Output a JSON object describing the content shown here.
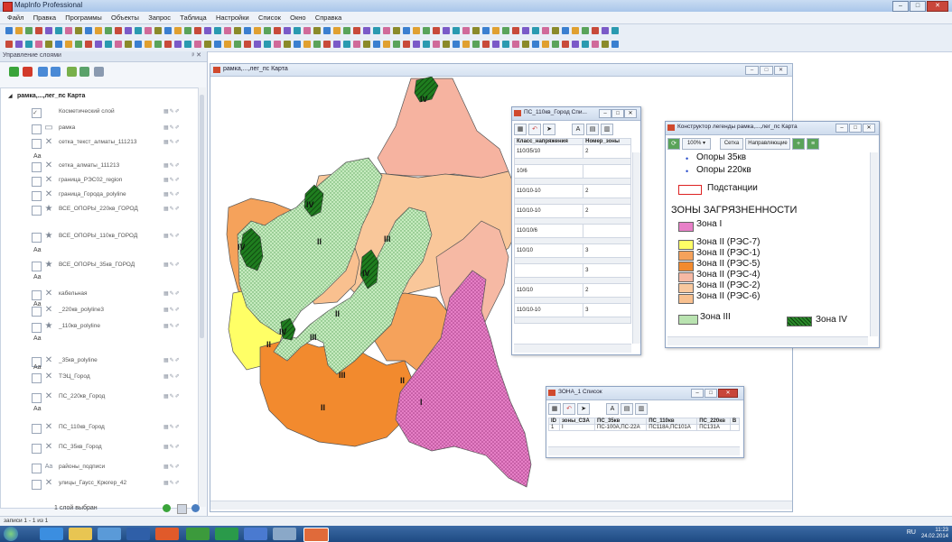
{
  "app": {
    "title": "MapInfo Professional"
  },
  "menu": [
    "Файл",
    "Правка",
    "Программы",
    "Объекты",
    "Запрос",
    "Таблица",
    "Настройки",
    "Список",
    "Окно",
    "Справка"
  ],
  "layer_panel": {
    "title": "Управление слоями",
    "map_name": "рамка,...,лег_пс Карта",
    "aa": "Aa",
    "layers": [
      {
        "name": "Косметический слой"
      },
      {
        "name": "рамка"
      },
      {
        "name": "сетка_текст_алматы_111213"
      },
      {
        "name": "сетка_алматы_111213"
      },
      {
        "name": "граница_РЭС02_region"
      },
      {
        "name": "граница_Города_polyline"
      },
      {
        "name": "ВСЕ_ОПОРЫ_220кв_ГОРОД"
      },
      {
        "name": "ВСЕ_ОПОРЫ_110кв_ГОРОД"
      },
      {
        "name": "ВСЕ_ОПОРЫ_35кв_ГОРОД"
      },
      {
        "name": "кабельная"
      },
      {
        "name": "_220кв_polyline3"
      },
      {
        "name": "_110кв_polyline"
      },
      {
        "name": "_35кв_polyline"
      },
      {
        "name": "ТЭЦ_Город"
      },
      {
        "name": "ПС_220кв_Город"
      },
      {
        "name": "ПС_110кв_Город"
      },
      {
        "name": "ПС_35кв_Город"
      },
      {
        "name": "районы_подписи"
      },
      {
        "name": "улицы_Гаусс_Крюгер_42"
      }
    ],
    "footer": "1 слой выбран"
  },
  "map_window": {
    "title": "рамка,...,лег_пс Карта",
    "labels": {
      "z1": "I",
      "z2": "II",
      "z3": "III",
      "z4": "IV"
    }
  },
  "ps_list": {
    "title": "ПС_110кв_Город Спи...",
    "columns": [
      "Класс_напряжения",
      "Номер_зоны"
    ],
    "rows": [
      [
        "110/35/10",
        "2"
      ],
      [
        "10/6",
        ""
      ],
      [
        "110/10-10",
        "2"
      ],
      [
        "110/10-10",
        "2"
      ],
      [
        "110/10/6",
        ""
      ],
      [
        "110/10",
        "3"
      ],
      [
        "",
        "3"
      ],
      [
        "110/10",
        "2"
      ],
      [
        "110/10-10",
        "3"
      ]
    ]
  },
  "legend": {
    "title": "Конструктор легенды рамка,...,лег_пс Карта",
    "zoom": "100%",
    "btn_grid": "Сетка",
    "btn_guides": "Направляющие",
    "items": {
      "op35": "Опоры 35кв",
      "op220": "Опоры 220кв",
      "subst": "Подстанции",
      "header": "ЗОНЫ ЗАГРЯЗНЕННОСТИ",
      "z1": "Зона I",
      "z2_7": "Зона II (РЭС-7)",
      "z2_1": "Зона II (РЭС-1)",
      "z2_5": "Зона II (РЭС-5)",
      "z2_4": "Зона II (РЭС-4)",
      "z2_2": "Зона II (РЭС-2)",
      "z2_6": "Зона II (РЭС-6)",
      "z3": "Зона III",
      "z4": "Зона IV"
    },
    "colors": {
      "z1": "#e880c8",
      "z2_7": "#ffff66",
      "z2_1": "#f5a25b",
      "z2_5": "#f28a2e",
      "z2_4": "#f6b9a4",
      "z2_2": "#f9c89e",
      "z2_6": "#f8c08f",
      "z3": "#b9e3b0",
      "z4": "#2a8a2a"
    }
  },
  "zone_list": {
    "title": "ЗОНА_1 Список",
    "columns": [
      "ID",
      "зоны_СЗА",
      "ПС_35кв",
      "ПС_110кв",
      "ПС_220кв",
      "В"
    ],
    "row": [
      "1",
      "I",
      "ПС-100А,ПС-22А",
      "ПС118А,ПС101А",
      "ПС131А",
      ""
    ]
  },
  "status": {
    "records": "записи 1 - 1 из 1"
  },
  "taskbar": {
    "lang": "RU",
    "time": "11:23",
    "date": "24.02.2014"
  }
}
